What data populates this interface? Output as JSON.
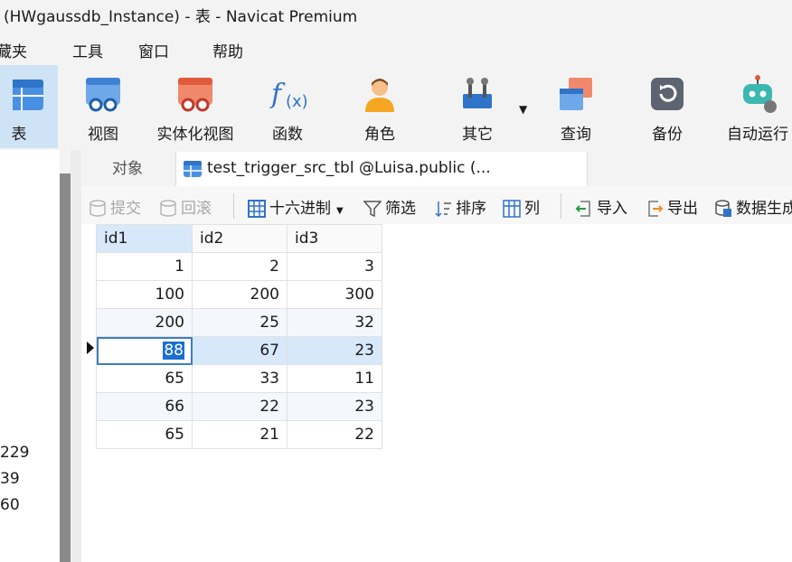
{
  "window": {
    "title": "(HWgaussdb_Instance) - 表 - Navicat Premium"
  },
  "menu": [
    "藏夹",
    "工具",
    "窗口",
    "帮助"
  ],
  "toolbar": {
    "buttons": [
      {
        "label": "表",
        "icon": "table-icon"
      },
      {
        "label": "视图",
        "icon": "view-icon"
      },
      {
        "label": "实体化视图",
        "icon": "materialized-view-icon"
      },
      {
        "label": "函数",
        "icon": "function-icon"
      },
      {
        "label": "角色",
        "icon": "user-role-icon"
      },
      {
        "label": "其它",
        "icon": "tools-icon"
      },
      {
        "label": "查询",
        "icon": "query-icon"
      },
      {
        "label": "备份",
        "icon": "backup-icon"
      },
      {
        "label": "自动运行",
        "icon": "robot-icon"
      }
    ]
  },
  "left_panel": {
    "values": [
      "229",
      "39",
      "60"
    ]
  },
  "tabs": {
    "objects": "对象",
    "active": "test_trigger_src_tbl @Luisa.public (..."
  },
  "subtoolbar": {
    "commit": "提交",
    "rollback": "回滚",
    "hex": "十六进制",
    "filter": "筛选",
    "sort": "排序",
    "columns": "列",
    "import": "导入",
    "export": "导出",
    "datagen": "数据生成"
  },
  "grid": {
    "columns": [
      "id1",
      "id2",
      "id3"
    ],
    "rows": [
      [
        "1",
        "2",
        "3"
      ],
      [
        "100",
        "200",
        "300"
      ],
      [
        "200",
        "25",
        "32"
      ],
      [
        "88",
        "67",
        "23"
      ],
      [
        "65",
        "33",
        "11"
      ],
      [
        "66",
        "22",
        "23"
      ],
      [
        "65",
        "21",
        "22"
      ]
    ]
  },
  "colors": {
    "accent": "#1c6fd0",
    "selection": "#d6e8f9"
  }
}
